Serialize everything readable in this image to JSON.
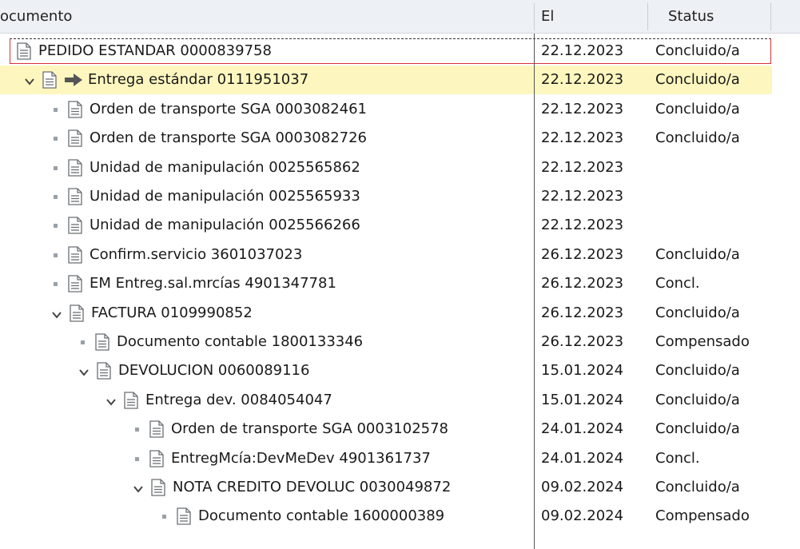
{
  "header": {
    "col_document": "ocumento",
    "col_date": "El",
    "col_status": "Status"
  },
  "rows": [
    {
      "label": "PEDIDO ESTANDAR 0000839758",
      "date": "22.12.2023",
      "status": "Concluido/a"
    },
    {
      "label": "Entrega estándar 0111951037",
      "date": "22.12.2023",
      "status": "Concluido/a"
    },
    {
      "label": "Orden de transporte SGA 0003082461",
      "date": "22.12.2023",
      "status": "Concluido/a"
    },
    {
      "label": "Orden de transporte SGA 0003082726",
      "date": "22.12.2023",
      "status": "Concluido/a"
    },
    {
      "label": "Unidad de manipulación 0025565862",
      "date": "22.12.2023",
      "status": ""
    },
    {
      "label": "Unidad de manipulación 0025565933",
      "date": "22.12.2023",
      "status": ""
    },
    {
      "label": "Unidad de manipulación 0025566266",
      "date": "22.12.2023",
      "status": ""
    },
    {
      "label": "Confirm.servicio 3601037023",
      "date": "26.12.2023",
      "status": "Concluido/a"
    },
    {
      "label": "EM Entreg.sal.mrcías 4901347781",
      "date": "26.12.2023",
      "status": "Concl."
    },
    {
      "label": "FACTURA 0109990852",
      "date": "26.12.2023",
      "status": "Concluido/a"
    },
    {
      "label": "Documento contable 1800133346",
      "date": "26.12.2023",
      "status": "Compensado"
    },
    {
      "label": "DEVOLUCION 0060089116",
      "date": "15.01.2024",
      "status": "Concluido/a"
    },
    {
      "label": "Entrega dev. 0084054047",
      "date": "15.01.2024",
      "status": "Concluido/a"
    },
    {
      "label": "Orden de transporte SGA 0003102578",
      "date": "24.01.2024",
      "status": "Concluido/a"
    },
    {
      "label": "EntregMcía:DevMeDev 4901361737",
      "date": "24.01.2024",
      "status": "Concl."
    },
    {
      "label": "NOTA CREDITO DEVOLUC 0030049872",
      "date": "09.02.2024",
      "status": "Concluido/a"
    },
    {
      "label": "Documento contable 1600000389",
      "date": "09.02.2024",
      "status": "Compensado"
    }
  ],
  "icons": {
    "document": "document-icon",
    "expand": "chevron-down-icon",
    "leaf": "bullet-icon",
    "current": "arrow-right-icon"
  },
  "colors": {
    "highlight_row": "#fdf7bf",
    "focus_border": "#d8323a",
    "arrow": "#555555"
  }
}
